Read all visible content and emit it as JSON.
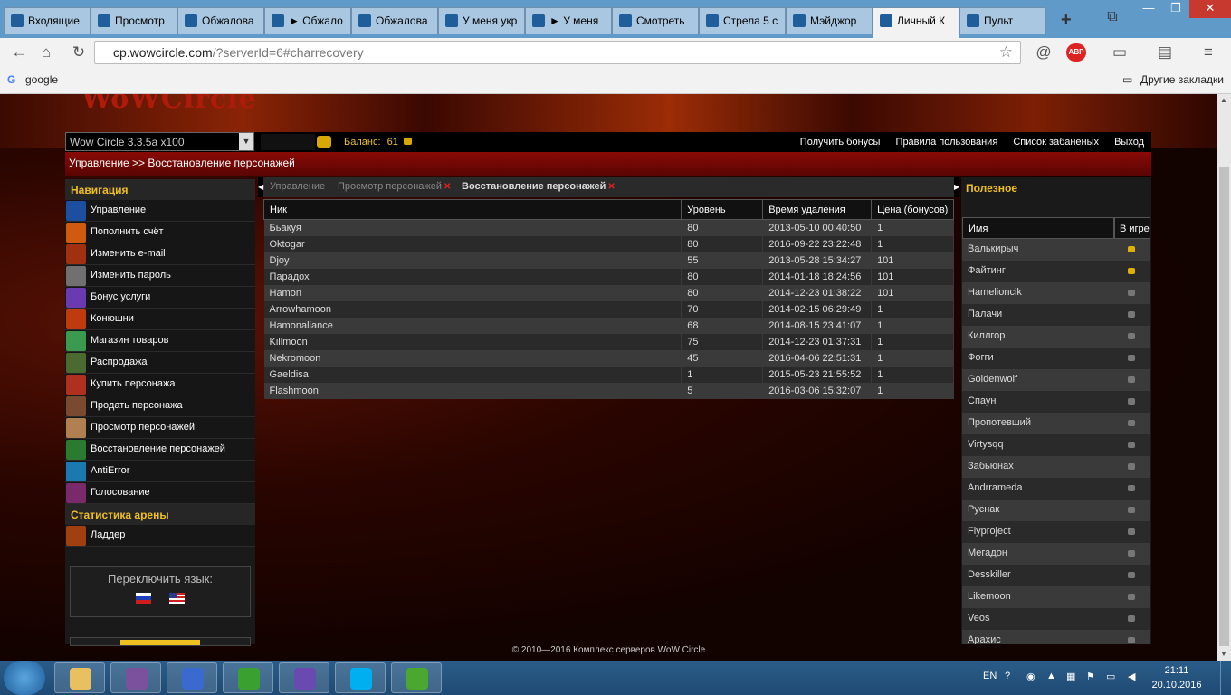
{
  "browser": {
    "tabs": [
      {
        "label": "Входящие",
        "active": false
      },
      {
        "label": "Просмотр",
        "active": false
      },
      {
        "label": "Обжалова",
        "active": false
      },
      {
        "label": "► Обжало",
        "active": false
      },
      {
        "label": "Обжалова",
        "active": false
      },
      {
        "label": "У меня укр",
        "active": false
      },
      {
        "label": "► У меня",
        "active": false
      },
      {
        "label": "Смотреть",
        "active": false
      },
      {
        "label": "Стрела 5 с",
        "active": false
      },
      {
        "label": "Мэйджор",
        "active": false
      },
      {
        "label": "Личный К",
        "active": true
      },
      {
        "label": "Пульт",
        "active": false
      }
    ],
    "url_host": "cp.wowcircle.com",
    "url_path": "/?serverId=6#charrecovery",
    "bookmarks": {
      "google": "google",
      "other": "Другие закладки"
    }
  },
  "site": {
    "logo": "WoWCircle",
    "server_select": "Wow Circle 3.3.5a x100",
    "balance_label": "Баланс:",
    "balance_value": "61",
    "top_links": [
      "Получить бонусы",
      "Правила пользования",
      "Список забаненых",
      "Выход"
    ],
    "breadcrumb": "Управление >> Восстановление персонажей"
  },
  "nav": {
    "heading": "Навигация",
    "items": [
      {
        "label": "Управление",
        "color": "#1c4fa0"
      },
      {
        "label": "Пополнить счёт",
        "color": "#d05a10"
      },
      {
        "label": "Изменить e-mail",
        "color": "#a03010"
      },
      {
        "label": "Изменить пароль",
        "color": "#707070"
      },
      {
        "label": "Бонус услуги",
        "color": "#6a3ab0"
      },
      {
        "label": "Конюшни",
        "color": "#c03a10"
      },
      {
        "label": "Магазин товаров",
        "color": "#3a9a50"
      },
      {
        "label": "Распродажа",
        "color": "#4a6a30"
      },
      {
        "label": "Купить персонажа",
        "color": "#b03020"
      },
      {
        "label": "Продать персонажа",
        "color": "#7a4a30"
      },
      {
        "label": "Просмотр персонажей",
        "color": "#b08050"
      },
      {
        "label": "Восстановление персонажей",
        "color": "#2a7a30"
      },
      {
        "label": "AntiError",
        "color": "#1a7ab0"
      },
      {
        "label": "Голосование",
        "color": "#7a2a6a"
      }
    ],
    "arena_heading": "Статистика арены",
    "arena_items": [
      {
        "label": "Ладдер",
        "color": "#a04010"
      }
    ],
    "lang_title": "Переключить язык:"
  },
  "content": {
    "tabs": [
      {
        "label": "Управление",
        "closable": false,
        "active": false
      },
      {
        "label": "Просмотр персонажей",
        "closable": true,
        "active": false
      },
      {
        "label": "Восстановление персонажей",
        "closable": true,
        "active": true
      }
    ],
    "columns": [
      "Ник",
      "Уровень",
      "Время удаления",
      "Цена (бонусов)"
    ],
    "rows": [
      [
        "Бьакуя",
        "80",
        "2013-05-10 00:40:50",
        "1"
      ],
      [
        "Oktogar",
        "80",
        "2016-09-22 23:22:48",
        "1"
      ],
      [
        "Djoy",
        "55",
        "2013-05-28 15:34:27",
        "101"
      ],
      [
        "Парадох",
        "80",
        "2014-01-18 18:24:56",
        "101"
      ],
      [
        "Hamon",
        "80",
        "2014-12-23 01:38:22",
        "101"
      ],
      [
        "Arrowhamoon",
        "70",
        "2014-02-15 06:29:49",
        "1"
      ],
      [
        "Hamonaliance",
        "68",
        "2014-08-15 23:41:07",
        "1"
      ],
      [
        "Killmoon",
        "75",
        "2014-12-23 01:37:31",
        "1"
      ],
      [
        "Nekromoon",
        "45",
        "2016-04-06 22:51:31",
        "1"
      ],
      [
        "Gaeldisa",
        "1",
        "2015-05-23 21:55:52",
        "1"
      ],
      [
        "Flashmoon",
        "5",
        "2016-03-06 15:32:07",
        "1"
      ]
    ]
  },
  "useful": {
    "heading": "Полезное",
    "col_name": "Имя",
    "col_online": "В игре",
    "players": [
      {
        "name": "Валькирыч",
        "online": true
      },
      {
        "name": "Файтинг",
        "online": true
      },
      {
        "name": "Hamelioncik",
        "online": false
      },
      {
        "name": "Палачи",
        "online": false
      },
      {
        "name": "Киллгор",
        "online": false
      },
      {
        "name": "Фогги",
        "online": false
      },
      {
        "name": "Goldenwolf",
        "online": false
      },
      {
        "name": "Спаун",
        "online": false
      },
      {
        "name": "Пропотевший",
        "online": false
      },
      {
        "name": "Virtysqq",
        "online": false
      },
      {
        "name": "Забьюнах",
        "online": false
      },
      {
        "name": "Andrrameda",
        "online": false
      },
      {
        "name": "Руснак",
        "online": false
      },
      {
        "name": "Flyproject",
        "online": false
      },
      {
        "name": "Мегадон",
        "online": false
      },
      {
        "name": "Desskiller",
        "online": false
      },
      {
        "name": "Likemoon",
        "online": false
      },
      {
        "name": "Veos",
        "online": false
      },
      {
        "name": "Арахис",
        "online": false
      }
    ]
  },
  "footer": "© 2010—2016 Комплекс серверов WoW Circle",
  "taskbar": {
    "apps": [
      {
        "name": "explorer-icon",
        "color": "#e8c060"
      },
      {
        "name": "viber-icon",
        "color": "#7b519d"
      },
      {
        "name": "hamachi-icon",
        "color": "#3a6ad0"
      },
      {
        "name": "agent-icon",
        "color": "#3aa030"
      },
      {
        "name": "vs-icon",
        "color": "#6a4ab0"
      },
      {
        "name": "skype-icon",
        "color": "#00aff0"
      },
      {
        "name": "utorrent-icon",
        "color": "#4aa830"
      }
    ],
    "lang": "EN",
    "time": "21:11",
    "date": "20.10.2016"
  }
}
